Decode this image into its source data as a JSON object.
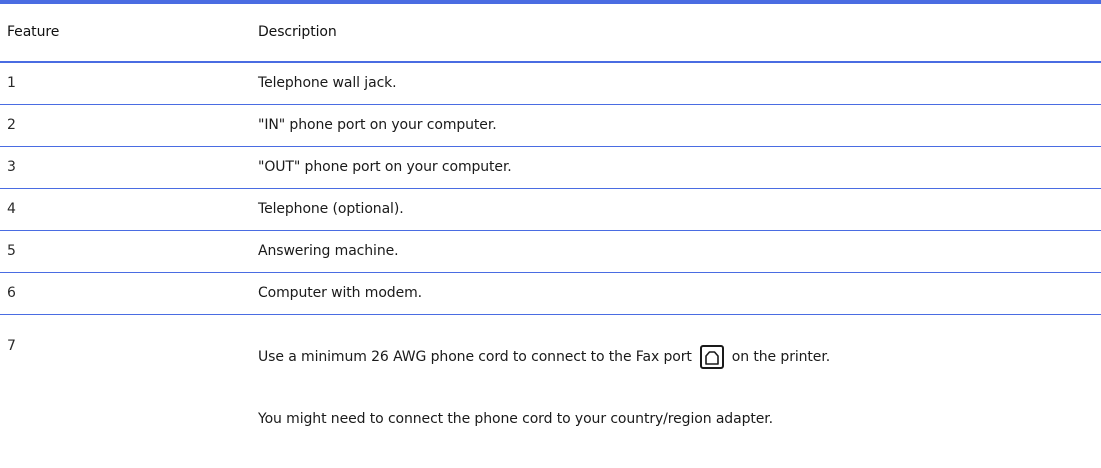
{
  "table": {
    "headers": {
      "feature": "Feature",
      "description": "Description"
    },
    "rows": [
      {
        "feature": "1",
        "description": "Telephone wall jack."
      },
      {
        "feature": "2",
        "description": "\"IN\" phone port on your computer."
      },
      {
        "feature": "3",
        "description": "\"OUT\" phone port on your computer."
      },
      {
        "feature": "4",
        "description": "Telephone (optional)."
      },
      {
        "feature": "5",
        "description": "Answering machine."
      },
      {
        "feature": "6",
        "description": "Computer with modem."
      }
    ],
    "last_row": {
      "feature": "7",
      "description_before_icon": "Use a minimum 26 AWG phone cord to connect to the Fax port",
      "icon": "fax-port-icon",
      "description_after_icon": "on the printer.",
      "note": "You might need to connect the phone cord to your country/region adapter."
    }
  },
  "colors": {
    "rule": "#4a6ce2",
    "text": "#1a1a1a"
  }
}
